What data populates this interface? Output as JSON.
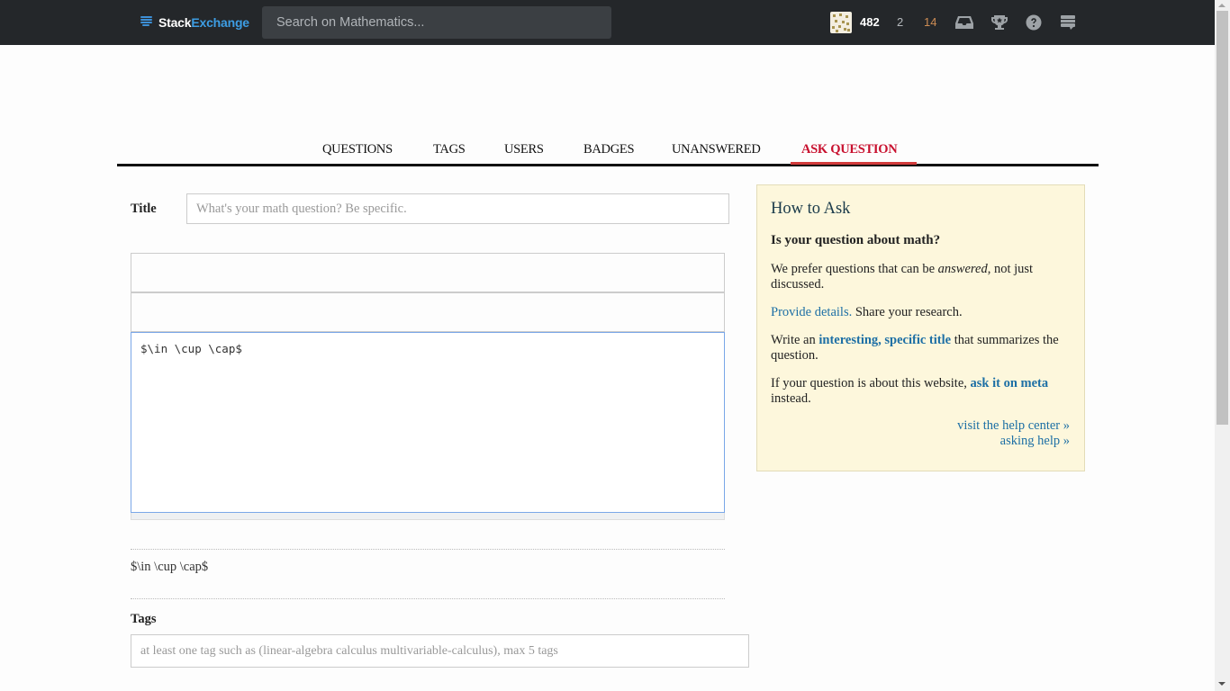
{
  "topbar": {
    "logo_stack": "Stack",
    "logo_exchange": "Exchange",
    "search_placeholder": "Search on Mathematics...",
    "reputation": "482",
    "silver_badges": "2",
    "bronze_badges": "14",
    "icons": [
      "inbox-icon",
      "achievements-trophy-icon",
      "help-icon",
      "site-switcher-icon"
    ],
    "colors": {
      "bar": "#24272a",
      "exchange_blue": "#3d9de3",
      "bronze": "#cc8c54"
    }
  },
  "nav": {
    "tabs": [
      {
        "label": "Questions",
        "active": false
      },
      {
        "label": "Tags",
        "active": false
      },
      {
        "label": "Users",
        "active": false
      },
      {
        "label": "Badges",
        "active": false
      },
      {
        "label": "Unanswered",
        "active": false
      },
      {
        "label": "Ask Question",
        "active": true
      }
    ],
    "active_color": "#c8102e"
  },
  "form": {
    "title_label": "Title",
    "title_placeholder": "What's your math question? Be specific.",
    "title_value": "",
    "body_value": "$\\in \\cup \\cap$",
    "preview_text": "$\\in \\cup \\cap$",
    "tags_label": "Tags",
    "tags_placeholder": "at least one tag such as (linear-algebra calculus multivariable-calculus), max 5 tags"
  },
  "howto": {
    "heading": "How to Ask",
    "question": "Is your question about math?",
    "p1_before": "We prefer questions that can be ",
    "p1_em": "answered",
    "p1_after": ", not just discussed.",
    "p2_link": "Provide details.",
    "p2_after": " Share your research.",
    "p3_before": "Write an ",
    "p3_link": "interesting, specific title",
    "p3_after": " that summarizes the question.",
    "p4_before": "If your question is about this website, ",
    "p4_link": "ask it on meta",
    "p4_after": " instead.",
    "link_help_center": "visit the help center »",
    "link_asking_help": "asking help »"
  }
}
